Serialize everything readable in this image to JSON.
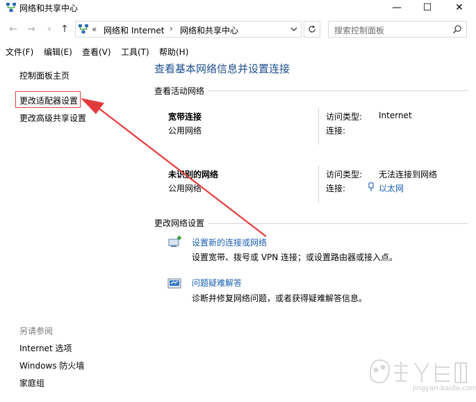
{
  "window": {
    "title": "网络和共享中心",
    "minimize": "—",
    "maximize": "☐",
    "close": "✕"
  },
  "navigation": {
    "back": "←",
    "forward": "→",
    "recent": "∨",
    "up": "↑",
    "address_chevron": "«",
    "breadcrumb_1": "网络和 Internet",
    "breadcrumb_sep": "›",
    "breadcrumb_2": "网络和共享中心",
    "search_placeholder": "搜索控制面板"
  },
  "menu": {
    "file": "文件(F)",
    "edit": "编辑(E)",
    "view": "查看(V)",
    "tools": "工具(T)",
    "help": "帮助(H)"
  },
  "sidebar": {
    "home": "控制面板主页",
    "adapter_settings": "更改适配器设置",
    "advanced_sharing": "更改高级共享设置",
    "see_also": "另请参阅",
    "internet_options": "Internet 选项",
    "firewall": "Windows 防火墙",
    "homegroup": "家庭组"
  },
  "main": {
    "title": "查看基本网络信息并设置连接",
    "active_networks_heading": "查看活动网络",
    "networks": [
      {
        "name": "宽带连接",
        "type": "公用网络",
        "access_label": "访问类型:",
        "access_value": "Internet",
        "connection_label": "连接:",
        "connection_value": ""
      },
      {
        "name": "未识别的网络",
        "type": "公用网络",
        "access_label": "访问类型:",
        "access_value": "无法连接到网络",
        "connection_label": "连接:",
        "connection_value": "以太网"
      }
    ],
    "change_settings_heading": "更改网络设置",
    "tasks": [
      {
        "link": "设置新的连接或网络",
        "description": "设置宽带、拨号或 VPN 连接；或设置路由器或接入点。"
      },
      {
        "link": "问题疑难解答",
        "description": "诊断并修复网络问题，或者获得疑难解答信息。"
      }
    ]
  },
  "watermark": {
    "text": "jingyan.baidu.com"
  },
  "colors": {
    "link_blue": "#1a5fb4",
    "title_blue": "#1e4e8c",
    "annotation_red": "#e23b3b"
  }
}
